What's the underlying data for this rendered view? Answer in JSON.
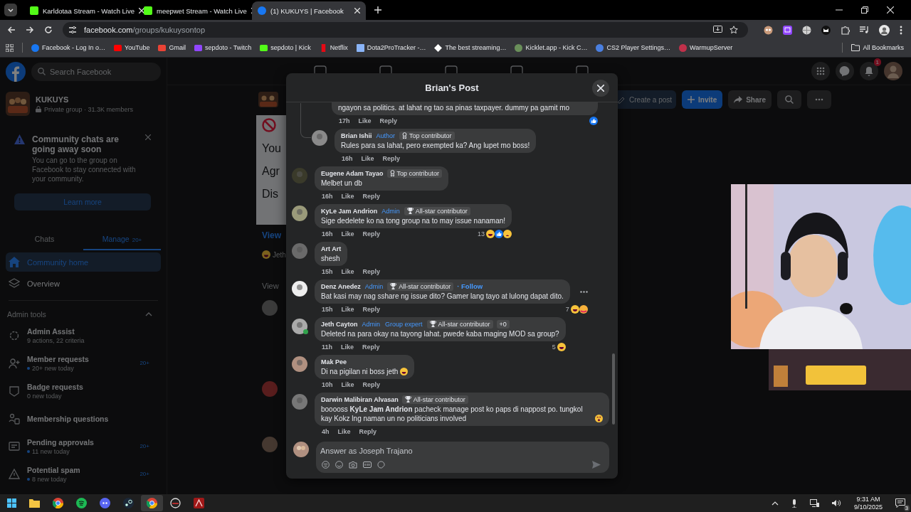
{
  "browser": {
    "tabs": [
      {
        "title": "Karldotaa Stream - Watch Live",
        "selected": false
      },
      {
        "title": "meepwet Stream - Watch Live",
        "selected": false
      },
      {
        "title": "(1) KUKUYS | Facebook",
        "selected": true
      }
    ],
    "address": {
      "host": "facebook.com",
      "path": "/groups/kukuysontop"
    },
    "bookmarks": [
      "Facebook - Log In o…",
      "YouTube",
      "Gmail",
      "sepdoto - Twitch",
      "sepdoto | Kick",
      "Netflix",
      "Dota2ProTracker -…",
      "The best streaming…",
      "Kicklet.app - Kick C…",
      "CS2 Player Settings…",
      "WarmupServer"
    ],
    "all_bookmarks": "All Bookmarks"
  },
  "facebook": {
    "search": {
      "placeholder": "Search Facebook"
    },
    "group": {
      "name": "KUKUYS",
      "meta": "Private group · 31.3K members"
    },
    "notice": {
      "title": "Community chats are going away soon",
      "body": "You can go to the group on Facebook to stay connected with your community.",
      "button": "Learn more"
    },
    "tabs": [
      {
        "label": "Chats",
        "selected": false
      },
      {
        "label": "Manage",
        "count": "20+",
        "selected": true
      }
    ],
    "nav": [
      {
        "label": "Community home",
        "selected": true
      },
      {
        "label": "Overview",
        "selected": false
      }
    ],
    "admin_tools": {
      "title": "Admin tools",
      "expanded": true,
      "items": [
        {
          "label": "Admin Assist",
          "sub": "9 actions, 22 criteria",
          "dot": false
        },
        {
          "label": "Member requests",
          "sub": "20+ new today",
          "dot": true,
          "badge": "20+"
        },
        {
          "label": "Badge requests",
          "sub": "0 new today",
          "dot": false
        },
        {
          "label": "Membership questions"
        },
        {
          "label": "Pending approvals",
          "sub": "11 new today",
          "dot": true,
          "badge": "20+"
        },
        {
          "label": "Potential spam",
          "sub": "8 new today",
          "dot": true,
          "badge": "20+"
        }
      ]
    },
    "notification_count": "1",
    "group_actions": [
      {
        "label": "Create a post",
        "kind": "edit"
      },
      {
        "label": "Invite",
        "kind": "invite"
      },
      {
        "label": "Share",
        "kind": "share"
      }
    ],
    "behind": {
      "card_lines": [
        "You",
        "Agr",
        "Dis"
      ],
      "view_link": "View",
      "reactor": "Jeth",
      "view_more": "View"
    }
  },
  "post_dialog": {
    "title": "Brian's Post",
    "comments": [
      {
        "kind": "tail",
        "text": "ngayon sa politics. at lahat ng tao sa pinas taxpayer. dummy pa gamit mo",
        "time": "17h",
        "like": "Like",
        "reply": "Reply",
        "reactions": [
          {
            "kind": "like"
          }
        ]
      },
      {
        "kind": "reply",
        "name": "Brian Ishii",
        "badges": [
          {
            "kind": "role",
            "text": "Author"
          },
          {
            "kind": "top",
            "text": "Top contributor"
          }
        ],
        "text": "Rules para sa lahat, pero exempted ka? Ang lupet mo boss!",
        "time": "16h",
        "like": "Like",
        "reply": "Reply"
      },
      {
        "kind": "comment",
        "name": "Eugene Adam Tayao",
        "badges": [
          {
            "kind": "top",
            "text": "Top contributor"
          }
        ],
        "text": "Melbet un db",
        "time": "16h",
        "like": "Like",
        "reply": "Reply"
      },
      {
        "kind": "comment",
        "name": "KyLe Jam Andrion",
        "badges": [
          {
            "kind": "role",
            "text": "Admin"
          },
          {
            "kind": "allstar",
            "text": "All-star contributor"
          }
        ],
        "text": "Sige dedelete ko na tong group na to may issue nanaman!",
        "time": "16h",
        "like": "Like",
        "reply": "Reply",
        "reaction_count": "13",
        "reactions": [
          {
            "kind": "haha"
          },
          {
            "kind": "like"
          },
          {
            "kind": "sad"
          }
        ]
      },
      {
        "kind": "comment",
        "name": "Art Art",
        "text": "shesh",
        "time": "15h",
        "like": "Like",
        "reply": "Reply"
      },
      {
        "kind": "comment",
        "name": "Denz Anedez",
        "badges": [
          {
            "kind": "role",
            "text": "Admin"
          },
          {
            "kind": "allstar",
            "text": "All-star contributor"
          }
        ],
        "follow": "· Follow",
        "menu": true,
        "text": "Bat kasi may nag sshare ng issue dito? Gamer lang tayo at lulong dapat dito.",
        "time": "15h",
        "like": "Like",
        "reply": "Reply",
        "reaction_count": "7",
        "reactions": [
          {
            "kind": "haha"
          },
          {
            "kind": "care"
          }
        ]
      },
      {
        "kind": "comment",
        "name": "Jeth Cayton",
        "online": true,
        "badges": [
          {
            "kind": "role",
            "text": "Admin"
          },
          {
            "kind": "role",
            "text": "Group expert"
          },
          {
            "kind": "allstar",
            "text": "All-star contributor"
          },
          {
            "kind": "more",
            "text": "+0"
          }
        ],
        "text": "Deleted na para okay na tayong lahat. pwede kaba maging MOD sa group?",
        "time": "11h",
        "like": "Like",
        "reply": "Reply",
        "reaction_count": "5",
        "reactions": [
          {
            "kind": "haha"
          }
        ]
      },
      {
        "kind": "comment",
        "name": "Mak Pee",
        "text": "Di na pigilan ni boss jeth",
        "emoji": {
          "kind": "haha"
        },
        "time": "10h",
        "like": "Like",
        "reply": "Reply"
      },
      {
        "kind": "comment",
        "name": "Darwin Malibiran Alvasan",
        "badges": [
          {
            "kind": "allstar",
            "text": "All-star contributor"
          }
        ],
        "text": "booooss **KyLe Jam Andrion** pacheck manage post ko paps di nappost po. tungkol kay Kokz lng naman un no politicians involved",
        "emoji": {
          "kind": "dizzy"
        },
        "time": "4h",
        "like": "Like",
        "reply": "Reply"
      }
    ],
    "composer": {
      "placeholder": "Answer as Joseph Trajano"
    }
  },
  "taskbar": {
    "time": "9:31 AM",
    "date": "9/10/2025",
    "notifications": "3"
  }
}
